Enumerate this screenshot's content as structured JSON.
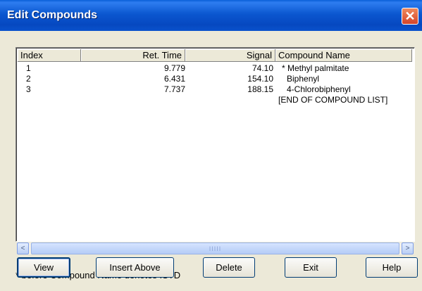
{
  "window": {
    "title": "Edit Compounds",
    "close_glyph": "✕"
  },
  "list": {
    "columns": [
      "Index",
      "Ret. Time",
      "Signal",
      "Compound Name"
    ],
    "rows": [
      {
        "index": "1",
        "ret_time": "9.779",
        "signal": "74.10",
        "name": "* Methyl palmitate"
      },
      {
        "index": "2",
        "ret_time": "6.431",
        "signal": "154.10",
        "name": "Biphenyl"
      },
      {
        "index": "3",
        "ret_time": "7.737",
        "signal": "188.15",
        "name": "4-Chlorobiphenyl"
      }
    ],
    "end_marker": "[END OF COMPOUND LIST]"
  },
  "scrollbar": {
    "left_arrow": "<",
    "right_arrow": ">",
    "thumb_grip": "IIIII"
  },
  "footnote": "* before Compound Name denotes ISTD",
  "buttons": {
    "view": "View",
    "insert_above": "Insert Above",
    "delete": "Delete",
    "exit": "Exit",
    "help": "Help"
  },
  "colors": {
    "titlebar": "#0b57d0",
    "close_button": "#d4442a",
    "dialog_background": "#ece9d8"
  },
  "icons": {
    "close": "close-icon",
    "scroll_left": "chevron-left-icon",
    "scroll_right": "chevron-right-icon"
  }
}
